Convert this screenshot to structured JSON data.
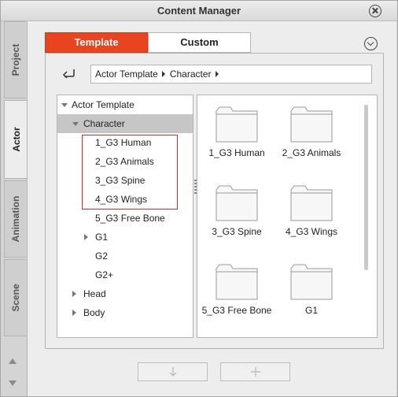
{
  "window": {
    "title": "Content Manager"
  },
  "side_tabs": [
    "Project",
    "Actor",
    "Animation",
    "Scene"
  ],
  "tabs": [
    {
      "label": "Template",
      "active": true
    },
    {
      "label": "Custom",
      "active": false
    }
  ],
  "breadcrumb": [
    "Actor Template",
    "Character"
  ],
  "tree": {
    "items": [
      {
        "label": "Actor Template",
        "level": 0,
        "expander": "down"
      },
      {
        "label": "Character",
        "level": 1,
        "expander": "down",
        "selected": true
      },
      {
        "label": "1_G3 Human",
        "level": 2
      },
      {
        "label": "2_G3 Animals",
        "level": 2
      },
      {
        "label": "3_G3 Spine",
        "level": 2
      },
      {
        "label": "4_G3 Wings",
        "level": 2
      },
      {
        "label": "5_G3 Free Bone",
        "level": 2
      },
      {
        "label": "G1",
        "level": 2,
        "expander": "right"
      },
      {
        "label": "G2",
        "level": 2
      },
      {
        "label": "G2+",
        "level": 2
      },
      {
        "label": "Head",
        "level": 1,
        "expander": "right"
      },
      {
        "label": "Body",
        "level": 1,
        "expander": "right"
      }
    ]
  },
  "grid": {
    "items": [
      {
        "label": "1_G3 Human"
      },
      {
        "label": "2_G3 Animals"
      },
      {
        "label": "3_G3 Spine"
      },
      {
        "label": "4_G3 Wings"
      },
      {
        "label": "5_G3 Free Bone"
      },
      {
        "label": "G1"
      }
    ]
  },
  "bottom_buttons": [
    {
      "icon": "download-arrow-icon"
    },
    {
      "icon": "plus-icon"
    }
  ],
  "colors": {
    "accent": "#e8441f",
    "highlight_box": "#e02828",
    "selected_row": "#c6c6c6"
  }
}
